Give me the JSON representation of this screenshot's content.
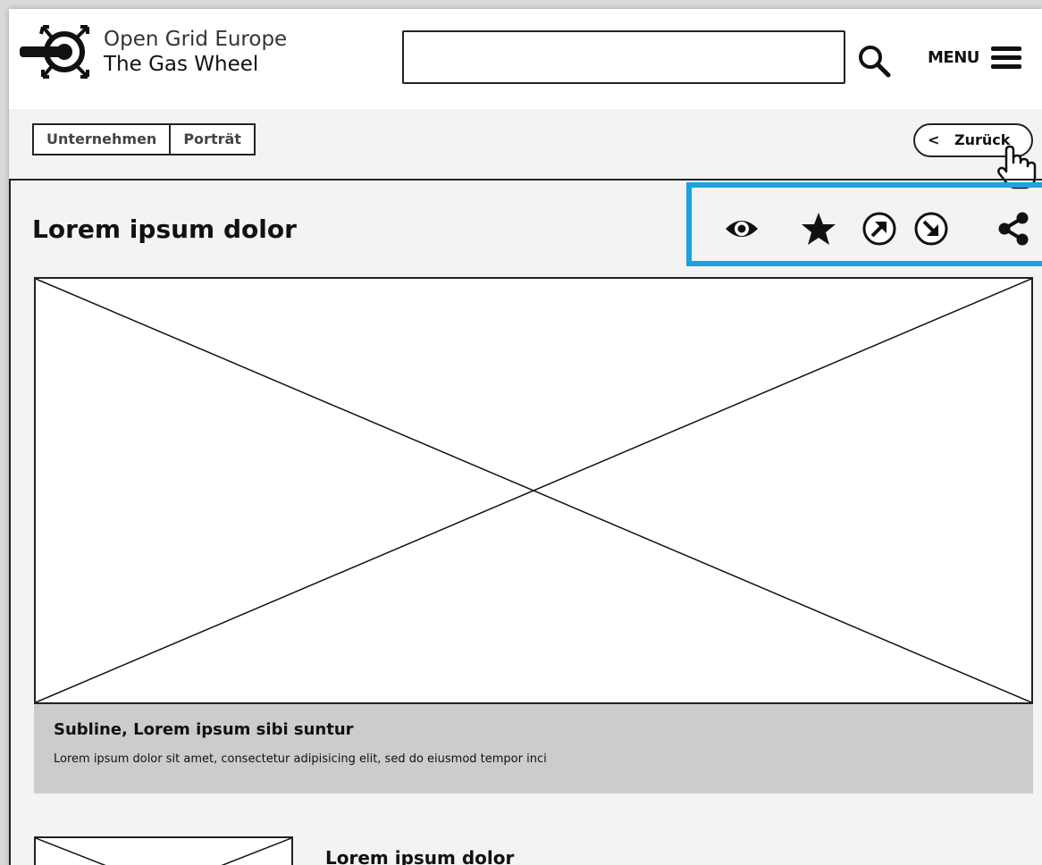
{
  "header": {
    "logo_line1": "Open Grid Europe",
    "logo_line2": "The Gas Wheel",
    "search": {
      "value": "",
      "placeholder": ""
    },
    "search_icon": "search-icon",
    "menu_label": "MENU",
    "menu_icon": "hamburger-icon"
  },
  "breadcrumb": {
    "items": [
      {
        "label": "Unternehmen"
      },
      {
        "label": "Porträt"
      }
    ]
  },
  "back_button": {
    "label": "Zurück",
    "icon": "chevron-left-icon"
  },
  "main": {
    "title": "Lorem ipsum dolor",
    "actions": [
      {
        "icon": "eye-icon"
      },
      {
        "icon": "star-icon"
      },
      {
        "icon": "circle-arrow-up-right-icon"
      },
      {
        "icon": "circle-arrow-down-right-icon"
      },
      {
        "icon": "share-icon"
      }
    ],
    "hero_caption": {
      "title": "Subline, Lorem ipsum sibi suntur",
      "text": "Lorem ipsum dolor sit amet, consectetur adipisicing elit, sed do eiusmod tempor inci"
    },
    "teaser_title": "Lorem ipsum dolor"
  },
  "colors": {
    "accent_highlight": "#1aa3e0",
    "page_background": "#f3f3f3",
    "caption_background": "#cccccc"
  }
}
